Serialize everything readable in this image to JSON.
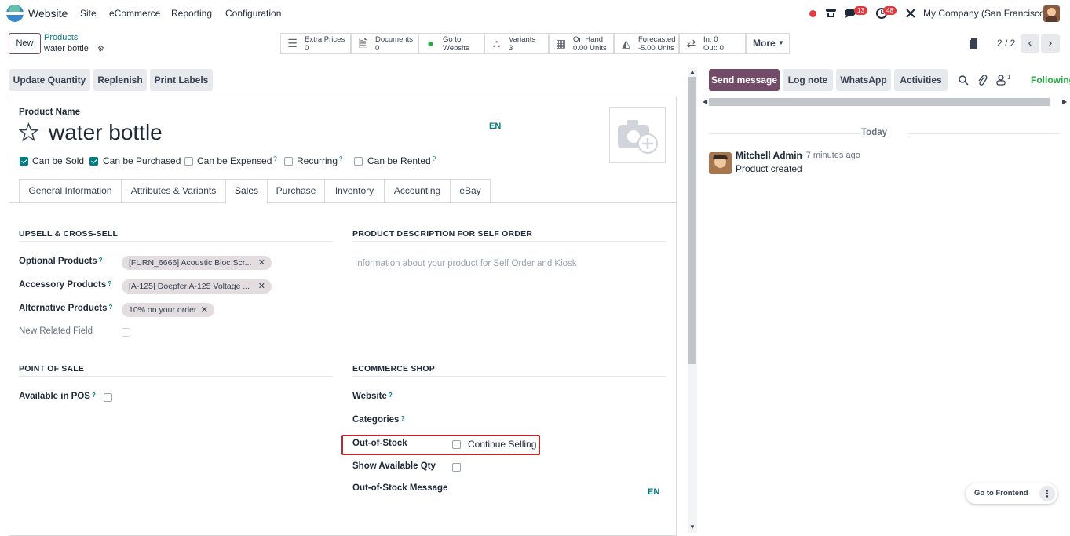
{
  "topnav": {
    "app_name": "Website",
    "menu": [
      "Site",
      "eCommerce",
      "Reporting",
      "Configuration"
    ],
    "chat_badge": "13",
    "activity_badge": "48",
    "company": "My Company (San Francisco)"
  },
  "control": {
    "new_label": "New",
    "breadcrumb_parent": "Products",
    "breadcrumb_current": "water bottle",
    "stat_buttons": [
      {
        "icon": "list-icon",
        "line1": "Extra Prices",
        "line2": "0"
      },
      {
        "icon": "document-icon",
        "line1": "Documents",
        "line2": "0"
      },
      {
        "icon": "globe-icon",
        "line1": "Go to",
        "line2": "Website"
      },
      {
        "icon": "sitemap-icon",
        "line1": "Variants",
        "line2": "3"
      },
      {
        "icon": "cubes-icon",
        "line1": "On Hand",
        "line2": "0.00 Units"
      },
      {
        "icon": "area-chart-icon",
        "line1": "Forecasted",
        "line2": "-5.00 Units"
      },
      {
        "icon": "exchange-icon",
        "line1": "In: 0",
        "line2": "Out: 0"
      }
    ],
    "more_label": "More",
    "pager": "2 / 2"
  },
  "actions": {
    "update_quantity": "Update Quantity",
    "replenish": "Replenish",
    "print_labels": "Print Labels"
  },
  "form": {
    "product_name_label": "Product Name",
    "product_name": "water bottle",
    "lang": "EN",
    "checkboxes": [
      {
        "label": "Can be Sold",
        "checked": true,
        "help": ""
      },
      {
        "label": "Can be Purchased",
        "checked": true,
        "help": ""
      },
      {
        "label": "Can be Expensed",
        "checked": false,
        "help": "?"
      },
      {
        "label": "Recurring",
        "checked": false,
        "help": "?"
      },
      {
        "label": "Can be Rented",
        "checked": false,
        "help": "?"
      }
    ],
    "tabs": [
      "General Information",
      "Attributes & Variants",
      "Sales",
      "Purchase",
      "Inventory",
      "Accounting",
      "eBay"
    ],
    "active_tab": "Sales",
    "upsell": {
      "title": "UPSELL & CROSS-SELL",
      "optional_label": "Optional Products",
      "optional_tag": "[FURN_6666] Acoustic Bloc Scr...",
      "accessory_label": "Accessory Products",
      "accessory_tag": "[A-125] Doepfer A-125 Voltage ...",
      "alternative_label": "Alternative Products",
      "alternative_tag": "10% on your order",
      "new_related_label": "New Related Field",
      "help": "?"
    },
    "self_order": {
      "title": "PRODUCT DESCRIPTION FOR SELF ORDER",
      "placeholder": "Information about your product for Self Order and Kiosk"
    },
    "pos": {
      "title": "POINT OF SALE",
      "available_label": "Available in POS"
    },
    "ecommerce": {
      "title": "ECOMMERCE SHOP",
      "website_label": "Website",
      "categories_label": "Categories",
      "out_of_stock_label": "Out-of-Stock",
      "continue_selling": "Continue Selling",
      "show_qty_label": "Show Available Qty",
      "oos_message_label": "Out-of-Stock Message",
      "lang": "EN"
    }
  },
  "chatter": {
    "send_message": "Send message",
    "log_note": "Log note",
    "whatsapp": "WhatsApp",
    "activities": "Activities",
    "followers_count": "1",
    "following": "Following",
    "date_sep": "Today",
    "author": "Mitchell Admin",
    "time": "- 7 minutes ago",
    "body": "Product created"
  },
  "go_frontend": "Go to Frontend"
}
